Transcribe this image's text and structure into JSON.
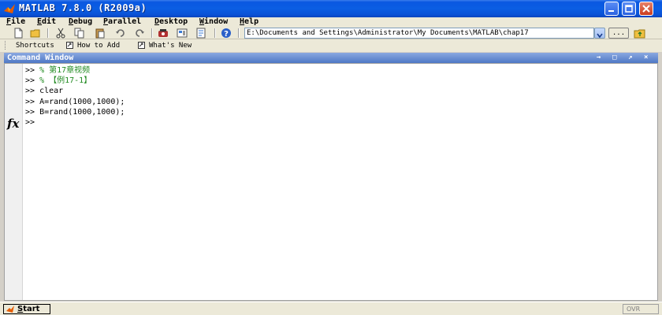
{
  "window": {
    "title": "MATLAB  7.8.0 (R2009a)"
  },
  "menu": [
    {
      "label": "File",
      "ul": "F",
      "rest": "ile"
    },
    {
      "label": "Edit",
      "ul": "E",
      "rest": "dit"
    },
    {
      "label": "Debug",
      "ul": "D",
      "rest": "ebug"
    },
    {
      "label": "Parallel",
      "ul": "P",
      "rest": "arallel"
    },
    {
      "label": "Desktop",
      "ul": "D",
      "rest": "esktop"
    },
    {
      "label": "Window",
      "ul": "W",
      "rest": "indow"
    },
    {
      "label": "Help",
      "ul": "H",
      "rest": "elp"
    }
  ],
  "toolbar": {
    "current_folder": "E:\\Documents and Settings\\Administrator\\My Documents\\MATLAB\\chap17",
    "browse_label": "..."
  },
  "shortcuts": {
    "label": "Shortcuts",
    "how_to_add": "How to Add",
    "whats_new": "What's New"
  },
  "command_window": {
    "title": "Command Window",
    "controls": [
      "→",
      "□",
      "↗",
      "×"
    ],
    "prompt": ">>",
    "lines": [
      {
        "type": "comment",
        "text": "% 第17章视频"
      },
      {
        "type": "comment",
        "text": "% 【例17-1】"
      },
      {
        "type": "code",
        "text": "clear"
      },
      {
        "type": "code",
        "text": "A=rand(1000,1000);"
      },
      {
        "type": "code",
        "text": "B=rand(1000,1000);"
      },
      {
        "type": "code",
        "text": ""
      }
    ],
    "fx_label": "fx"
  },
  "statusbar": {
    "start_ul": "S",
    "start_rest": "tart",
    "ovr": "OVR"
  },
  "colors": {
    "title_blue": "#0b5ee3",
    "comment_green": "#228b22",
    "panel_header": "#4f78c6"
  }
}
